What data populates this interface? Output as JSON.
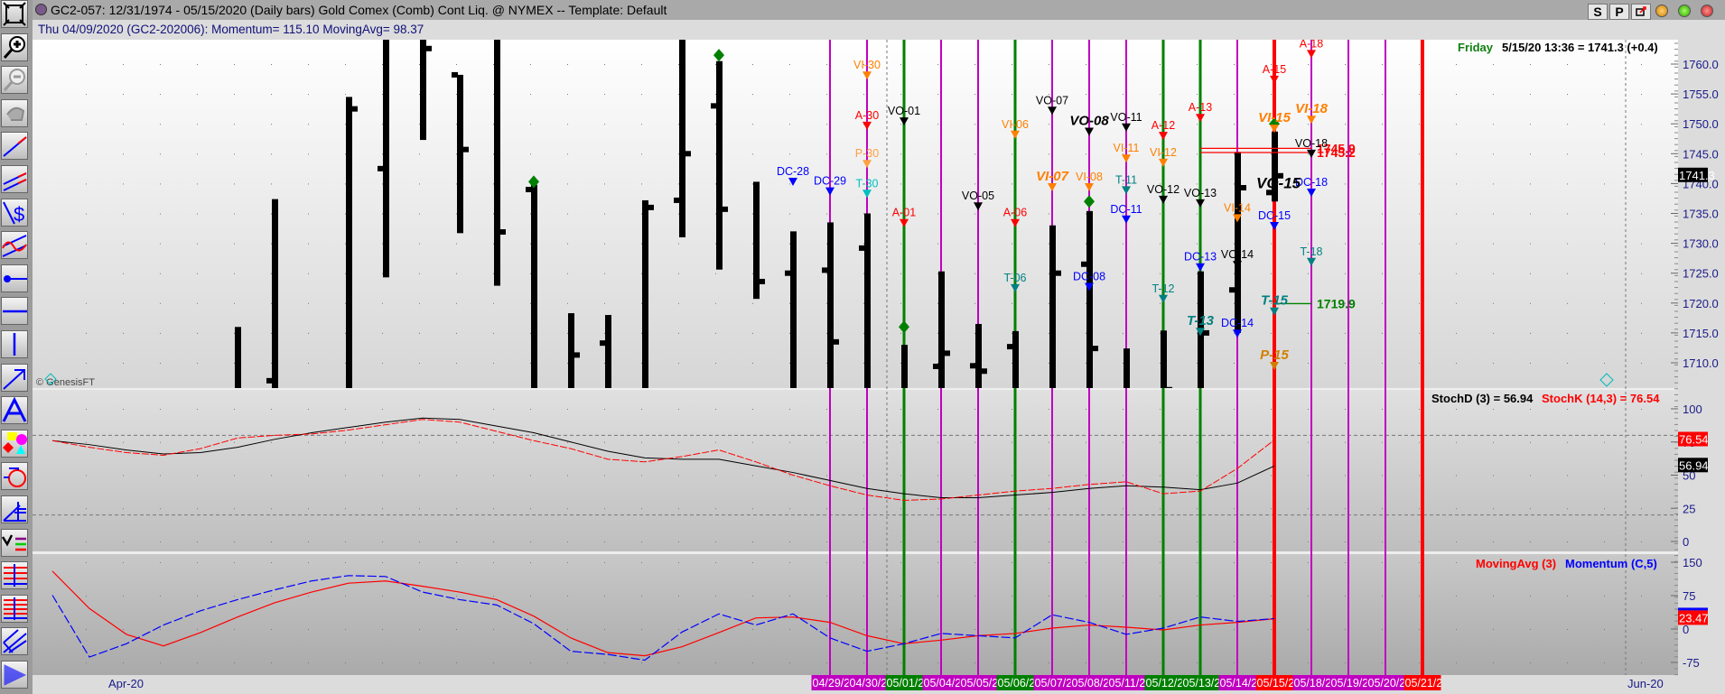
{
  "window": {
    "title": "GC2-057:  12/31/1974 - 05/15/2020  (Daily bars)   Gold Comex (Comb) Cont Liq. @ NYMEX  --  Template: Default",
    "buttons": {
      "s": "S",
      "p": "P"
    }
  },
  "info_line": "Thu  04/09/2020 (GC2-202006):  Momentum= 115.10  MovingAvg= 98.37",
  "price_pane": {
    "day": "Friday",
    "quote": "5/15/20 13:36 = 1741.3 (+0.4)",
    "last_price_box": "1741.3",
    "copyright": "© GenesisFT",
    "axis_labels": [
      "1760.0",
      "1755.0",
      "1750.0",
      "1745.0",
      "1740.0",
      "1735.0",
      "1730.0",
      "1725.0",
      "1720.0",
      "1715.0",
      "1710.0"
    ],
    "axis_values": [
      1760,
      1755,
      1750,
      1745,
      1740,
      1735,
      1730,
      1725,
      1720,
      1715,
      1710
    ],
    "level_lines": [
      {
        "label": "1745.9",
        "value": 1745.9,
        "from_bar": 31,
        "to_bar": 34,
        "color": "#ff0000"
      },
      {
        "label": "1745.2",
        "value": 1745.2,
        "from_bar": 31,
        "to_bar": 34,
        "color": "#ff0000"
      },
      {
        "label": "1719.9",
        "value": 1719.9,
        "from_bar": 33,
        "to_bar": 34,
        "color": "#008000"
      }
    ]
  },
  "stoch_pane": {
    "legend_d": "StochD (3) = 56.94",
    "legend_k": "StochK (14,3) = 76.54",
    "box_k": "76.54",
    "box_d": "56.94",
    "axis_labels": [
      "100",
      "75",
      "50",
      "25",
      "0"
    ],
    "axis_values": [
      100,
      75,
      50,
      25,
      0
    ]
  },
  "momentum_pane": {
    "legend_ma": "MovingAvg (3)",
    "legend_mom": "Momentum (C,5)",
    "box_value": "23.47",
    "axis_labels": [
      "150",
      "75",
      "0",
      "-75"
    ],
    "axis_values": [
      150,
      75,
      0,
      -75
    ]
  },
  "date_axis": {
    "left_month": "Apr-20",
    "right_month": "Jun-20"
  },
  "colors": {
    "magenta": "#c000c0",
    "green": "#008000",
    "red": "#ff0000",
    "orange": "#ff8000",
    "blue": "#0000ff",
    "teal": "#008080",
    "black": "#000000"
  },
  "chart_data": {
    "type": "ohlc",
    "first_line_bar": 21,
    "vertical_lines": [
      {
        "date": "04/29/20",
        "color": "#c000c0"
      },
      {
        "date": "04/30/20",
        "color": "#c000c0"
      },
      {
        "date": "05/01/20",
        "color": "#008000"
      },
      {
        "date": "05/04/20",
        "color": "#c000c0"
      },
      {
        "date": "05/05/20",
        "color": "#c000c0"
      },
      {
        "date": "05/06/20",
        "color": "#008000"
      },
      {
        "date": "05/07/20",
        "color": "#c000c0"
      },
      {
        "date": "05/08/20",
        "color": "#c000c0"
      },
      {
        "date": "05/11/20",
        "color": "#c000c0"
      },
      {
        "date": "05/12/20",
        "color": "#008000"
      },
      {
        "date": "05/13/20",
        "color": "#008000"
      },
      {
        "date": "05/14/20",
        "color": "#c000c0"
      },
      {
        "date": "05/15/20",
        "color": "#ff0000"
      },
      {
        "date": "05/18/20",
        "color": "#c000c0"
      },
      {
        "date": "05/19/20",
        "color": "#c000c0"
      },
      {
        "date": "05/20/20",
        "color": "#c000c0"
      },
      {
        "date": "05/21/20",
        "color": "#ff0000"
      }
    ],
    "bars": [
      {
        "i": 5,
        "h": 1716,
        "l": 1700
      },
      {
        "i": 6,
        "h": 1737.4,
        "l": 1700,
        "o": 1707
      },
      {
        "i": 8,
        "h": 1754.5,
        "l": 1700,
        "c": 1752.5
      },
      {
        "i": 9,
        "h": 1770,
        "l": 1724.3,
        "o": 1742.5
      },
      {
        "i": 10,
        "h": 1770,
        "l": 1747.3,
        "c": 1762.6
      },
      {
        "i": 11,
        "h": 1758.2,
        "l": 1731.7,
        "o": 1758.2,
        "c": 1745.7
      },
      {
        "i": 12,
        "h": 1770,
        "l": 1722.9,
        "c": 1731.9
      },
      {
        "i": 13,
        "h": 1739.8,
        "l": 1700,
        "o": 1739
      },
      {
        "i": 14,
        "h": 1718.3,
        "l": 1700,
        "c": 1711.3
      },
      {
        "i": 15,
        "h": 1718,
        "l": 1700,
        "o": 1713.3
      },
      {
        "i": 16,
        "h": 1737.2,
        "l": 1700,
        "c": 1736
      },
      {
        "i": 17,
        "h": 1770,
        "l": 1731,
        "o": 1737.2,
        "c": 1745
      },
      {
        "i": 18,
        "h": 1760.5,
        "l": 1725.6,
        "o": 1753,
        "c": 1735.7
      },
      {
        "i": 19,
        "h": 1740.3,
        "l": 1720.7,
        "c": 1723.6
      },
      {
        "i": 20,
        "h": 1732,
        "l": 1700,
        "o": 1725
      },
      {
        "i": 21,
        "h": 1733.5,
        "l": 1700,
        "o": 1725.5,
        "c": 1713.5
      },
      {
        "i": 22,
        "h": 1735,
        "l": 1700,
        "o": 1729.2
      },
      {
        "i": 23,
        "h": 1713,
        "l": 1700
      },
      {
        "i": 24,
        "h": 1725.3,
        "l": 1700,
        "o": 1709.4,
        "c": 1711.6
      },
      {
        "i": 25,
        "h": 1716.5,
        "l": 1700,
        "o": 1709.5,
        "c": 1708.6
      },
      {
        "i": 26,
        "h": 1715.3,
        "l": 1700,
        "o": 1712.7
      },
      {
        "i": 27,
        "h": 1733,
        "l": 1700,
        "c": 1725
      },
      {
        "i": 28,
        "h": 1735.4,
        "l": 1700,
        "o": 1726.5,
        "c": 1712.4
      },
      {
        "i": 29,
        "h": 1712.4,
        "l": 1700
      },
      {
        "i": 30,
        "h": 1715.4,
        "l": 1700,
        "c": 1705.5
      },
      {
        "i": 31,
        "h": 1725.3,
        "l": 1700,
        "c": 1715
      },
      {
        "i": 32,
        "h": 1745.3,
        "l": 1715,
        "o": 1722.2,
        "c": 1739.3
      },
      {
        "i": 33,
        "h": 1748.7,
        "l": 1737,
        "o": 1738.5,
        "c": 1741.3
      }
    ],
    "diamonds": [
      {
        "i": 13,
        "v": 1740.3
      },
      {
        "i": 18,
        "v": 1761.5
      },
      {
        "i": 23,
        "v": 1716
      },
      {
        "i": 28,
        "v": 1737
      },
      {
        "i": 33,
        "v": 1750
      }
    ],
    "markers": [
      {
        "label": "DC-28",
        "i": 20,
        "v": 1739.6,
        "color": "#0000ff"
      },
      {
        "label": "DC-29",
        "i": 21,
        "v": 1738,
        "color": "#0000ff"
      },
      {
        "label": "VI-30",
        "i": 22,
        "v": 1757.4,
        "color": "#ff8000"
      },
      {
        "label": "A-30",
        "i": 22,
        "v": 1749,
        "color": "#ff0000"
      },
      {
        "label": "P-30",
        "i": 22,
        "v": 1742.6,
        "color": "#ffa040"
      },
      {
        "label": "T-30",
        "i": 22,
        "v": 1737.6,
        "color": "#00c0c0"
      },
      {
        "label": "VO-01",
        "i": 23,
        "v": 1749.7,
        "color": "#000000"
      },
      {
        "label": "A-01",
        "i": 23,
        "v": 1732.7,
        "color": "#ff0000"
      },
      {
        "label": "VO-05",
        "i": 25,
        "v": 1735.5,
        "color": "#000000"
      },
      {
        "label": "VI-06",
        "i": 26,
        "v": 1747.5,
        "color": "#ff8000"
      },
      {
        "label": "A-06",
        "i": 26,
        "v": 1732.7,
        "color": "#ff0000"
      },
      {
        "label": "T-06",
        "i": 26,
        "v": 1721.8,
        "color": "#008080"
      },
      {
        "label": "VO-07",
        "i": 27,
        "v": 1751.5,
        "color": "#000000"
      },
      {
        "label": "VI-07",
        "i": 27,
        "v": 1738.7,
        "color": "#ff8000",
        "bold": true
      },
      {
        "label": "VO-08",
        "i": 28,
        "v": 1748,
        "color": "#000000",
        "bold": true
      },
      {
        "label": "VI-08",
        "i": 28,
        "v": 1738.7,
        "color": "#ff8000"
      },
      {
        "label": "DC-08",
        "i": 28,
        "v": 1722,
        "color": "#0000ff"
      },
      {
        "label": "VO-11",
        "i": 29,
        "v": 1748.7,
        "color": "#000000"
      },
      {
        "label": "VI-11",
        "i": 29,
        "v": 1743.5,
        "color": "#ff8000"
      },
      {
        "label": "T-11",
        "i": 29,
        "v": 1738.2,
        "color": "#008080"
      },
      {
        "label": "DC-11",
        "i": 29,
        "v": 1733.3,
        "color": "#0000ff"
      },
      {
        "label": "A-12",
        "i": 30,
        "v": 1747.3,
        "color": "#ff0000"
      },
      {
        "label": "VI-12",
        "i": 30,
        "v": 1742.8,
        "color": "#ff8000"
      },
      {
        "label": "VO-12",
        "i": 30,
        "v": 1736.6,
        "color": "#000000"
      },
      {
        "label": "T-12",
        "i": 30,
        "v": 1720,
        "color": "#008080"
      },
      {
        "label": "A-13",
        "i": 31,
        "v": 1750.3,
        "color": "#ff0000"
      },
      {
        "label": "VO-13",
        "i": 31,
        "v": 1736,
        "color": "#000000"
      },
      {
        "label": "DC-13",
        "i": 31,
        "v": 1725.3,
        "color": "#0000ff"
      },
      {
        "label": "T-13",
        "i": 31,
        "v": 1714.5,
        "color": "#008080",
        "bold": true
      },
      {
        "label": "VI-14",
        "i": 32,
        "v": 1733.5,
        "color": "#ff8000"
      },
      {
        "label": "VO-14",
        "i": 32,
        "v": 1725.7,
        "color": "#000000"
      },
      {
        "label": "DC-14",
        "i": 32,
        "v": 1714.2,
        "color": "#0000ff"
      },
      {
        "label": "A-15",
        "i": 33,
        "v": 1756.7,
        "color": "#ff0000"
      },
      {
        "label": "VI-15",
        "i": 33,
        "v": 1748.5,
        "color": "#ff8000",
        "bold": true
      },
      {
        "label": "DC-15",
        "i": 33,
        "v": 1732.2,
        "color": "#0000ff"
      },
      {
        "label": "T-15",
        "i": 33,
        "v": 1717.9,
        "color": "#008080",
        "bold": true
      },
      {
        "label": "P-15",
        "i": 33,
        "v": 1708.8,
        "color": "#d08000",
        "bold": true
      },
      {
        "label": "A-18",
        "i": 34,
        "v": 1761,
        "color": "#ff0000"
      },
      {
        "label": "VI-18",
        "i": 34,
        "v": 1750,
        "color": "#ff8000",
        "bold": true
      },
      {
        "label": "VO-18",
        "i": 34,
        "v": 1744.3,
        "color": "#000000"
      },
      {
        "label": "DC-18",
        "i": 34,
        "v": 1737.8,
        "color": "#0000ff"
      },
      {
        "label": "T-18",
        "i": 34,
        "v": 1726.2,
        "color": "#008080"
      }
    ],
    "free_labels": [
      {
        "label": "VO-15",
        "i": 33,
        "v": 1740,
        "color": "#000000"
      }
    ],
    "stoch_d": [
      76,
      73,
      69,
      66,
      67,
      71,
      77,
      82,
      86,
      90,
      93,
      92,
      87,
      82,
      75,
      68,
      63,
      62,
      62,
      57,
      52,
      46,
      40,
      36,
      33,
      33,
      35,
      37,
      40,
      42,
      41,
      39,
      44,
      56.94
    ],
    "stoch_k": [
      76,
      71,
      67,
      65,
      70,
      78,
      80,
      81,
      84,
      88,
      92,
      90,
      83,
      76,
      70,
      62,
      60,
      64,
      69,
      60,
      50,
      42,
      35,
      31,
      32,
      35,
      38,
      40,
      43,
      45,
      36,
      38,
      55,
      76.54
    ],
    "momentum": [
      76,
      -63,
      -33,
      9,
      41,
      66,
      88,
      108,
      120,
      118,
      83,
      66,
      54,
      12,
      -50,
      -57,
      -70,
      -7,
      34,
      9,
      34,
      -20,
      -50,
      -33,
      -10,
      -15,
      -20,
      32,
      15,
      -12,
      2,
      27,
      17,
      23.47
    ],
    "moving_avg": [
      130,
      46,
      -12,
      -38,
      -8,
      27,
      59,
      83,
      103,
      108,
      96,
      83,
      66,
      29,
      -20,
      -53,
      -60,
      -40,
      -8,
      25,
      27,
      15,
      -15,
      -33,
      -25,
      -15,
      -10,
      2,
      9,
      4,
      -2,
      9,
      15,
      23
    ]
  }
}
